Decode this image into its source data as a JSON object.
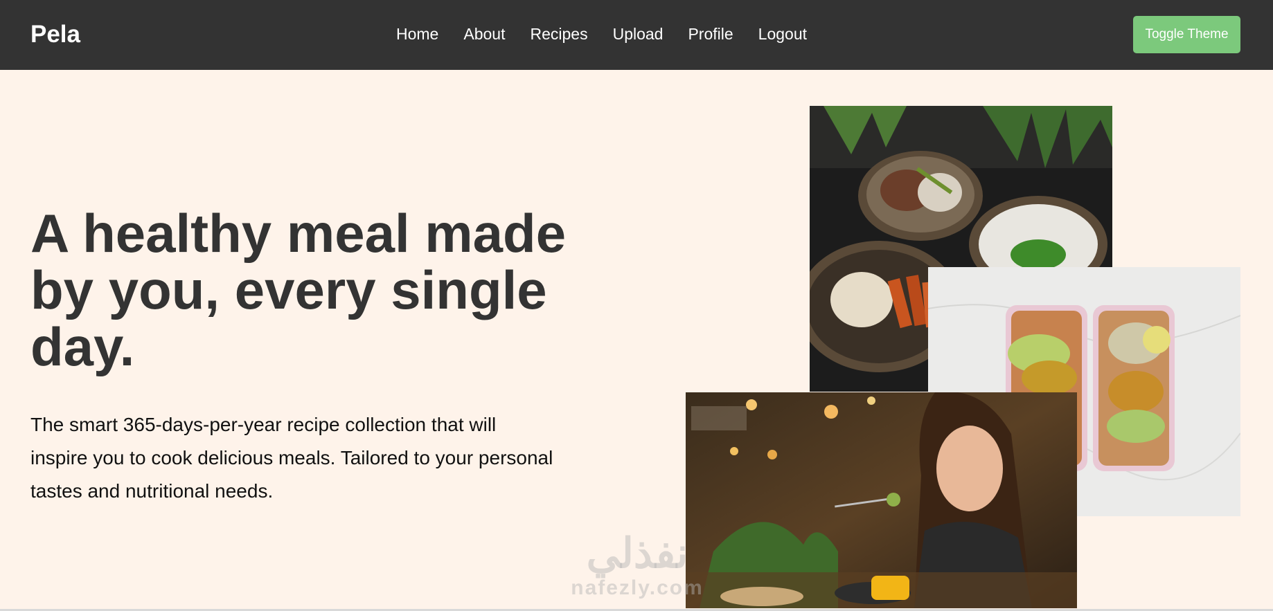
{
  "navbar": {
    "brand": "Pela",
    "links": [
      "Home",
      "About",
      "Recipes",
      "Upload",
      "Profile",
      "Logout"
    ],
    "toggle_theme": "Toggle Theme"
  },
  "hero": {
    "title": "A healthy meal made by you, every single day.",
    "description": "The smart 365-days-per-year recipe collection that will inspire you to cook delicious meals. Tailored to your personal tastes and nutritional needs."
  },
  "watermark": {
    "arabic": "نفذلي",
    "latin": "nafezly.com"
  },
  "colors": {
    "navbar_bg": "#333333",
    "page_bg": "#fef3ea",
    "toggle_button": "#7cc97c"
  }
}
